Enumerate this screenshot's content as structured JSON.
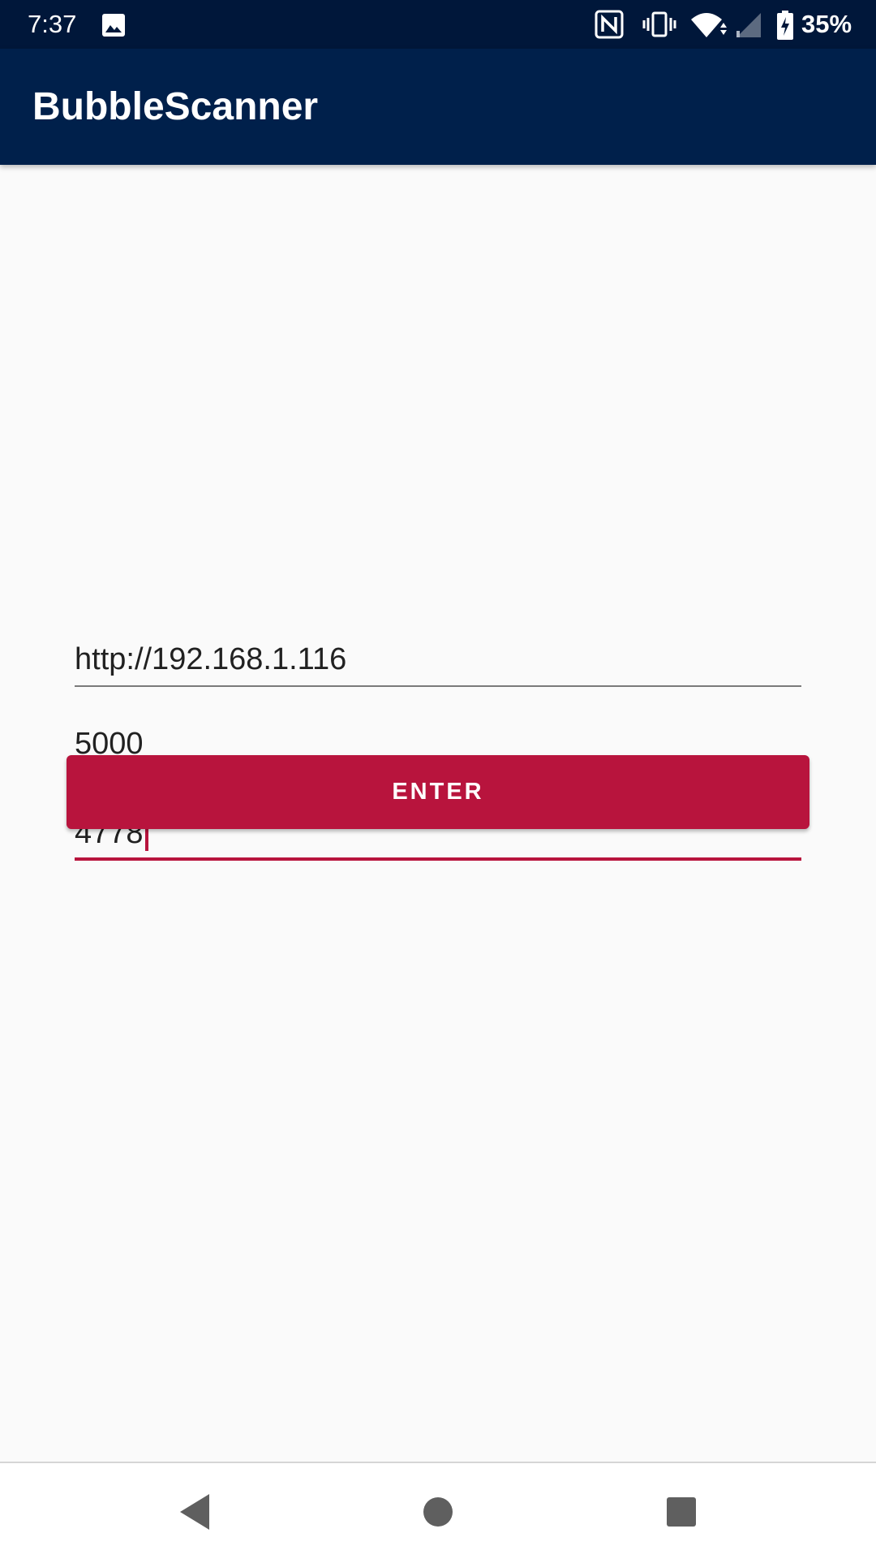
{
  "status_bar": {
    "time": "7:37",
    "battery_percent": "35%",
    "icons": [
      "image-icon",
      "nfc-icon",
      "vibrate-icon",
      "wifi-icon",
      "signal-icon",
      "battery-charging-icon"
    ]
  },
  "app_bar": {
    "title": "BubbleScanner"
  },
  "form": {
    "host_value": "http://192.168.1.116",
    "port_value": "5000",
    "code_value": "4778",
    "enter_label": "ENTER"
  },
  "nav_bar": {
    "icons": [
      "back-icon",
      "home-icon",
      "recents-icon"
    ]
  },
  "colors": {
    "status_bar": "#00173a",
    "app_bar": "#00204b",
    "accent": "#b8143d",
    "background": "#fafafa"
  }
}
